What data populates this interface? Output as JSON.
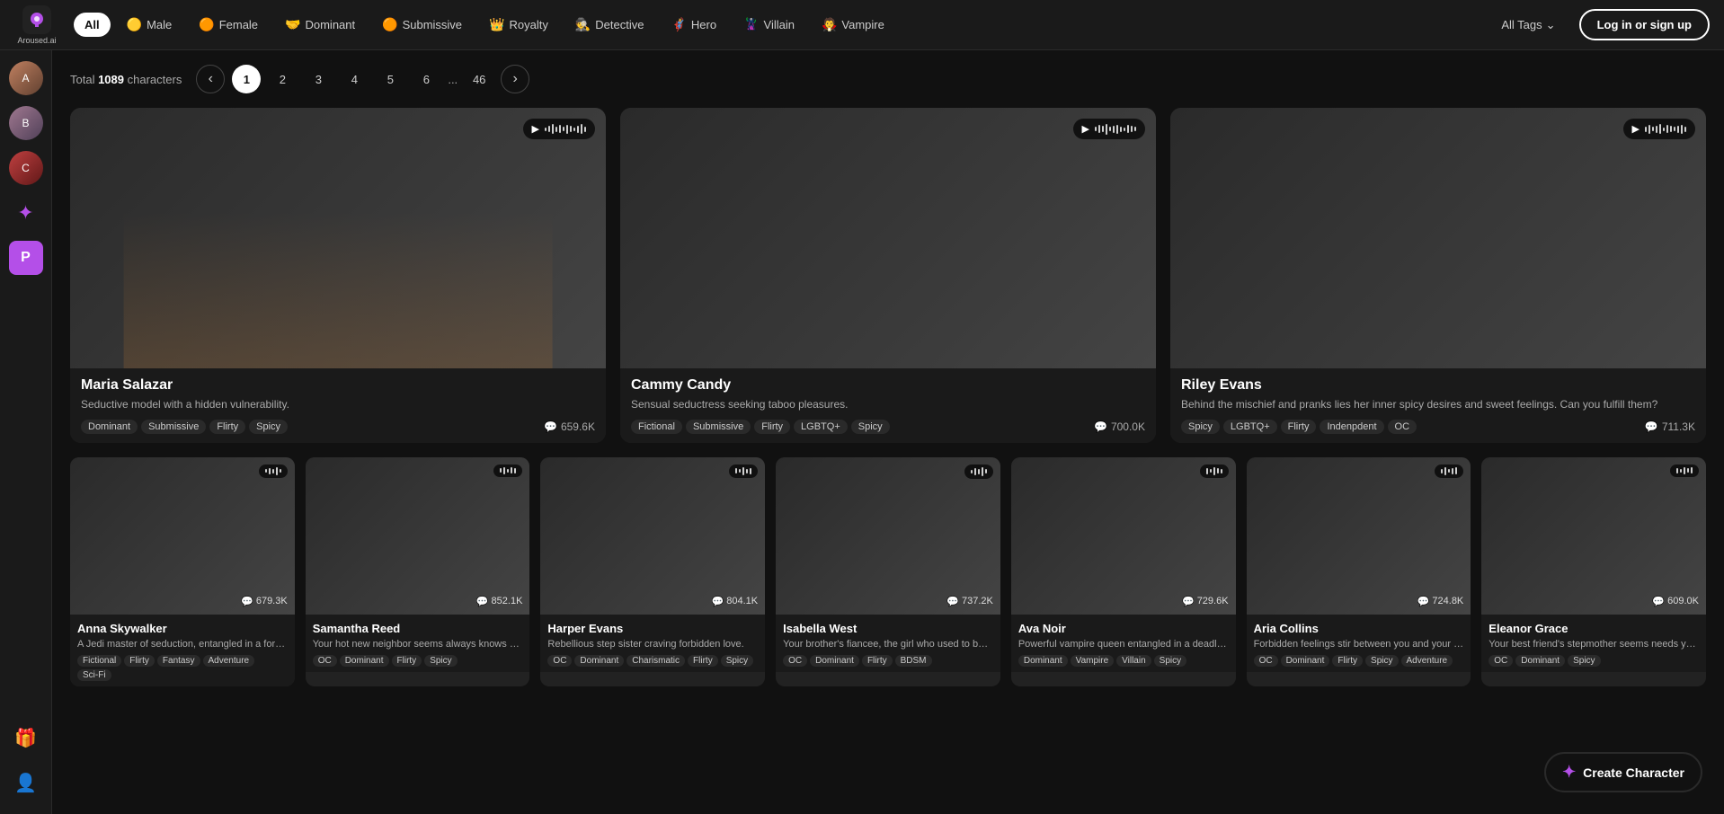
{
  "logo": {
    "icon": "A",
    "text": "Aroused.ai"
  },
  "nav": {
    "tags": [
      {
        "id": "all",
        "label": "All",
        "emoji": "",
        "active": true
      },
      {
        "id": "male",
        "label": "Male",
        "emoji": "🟡"
      },
      {
        "id": "female",
        "label": "Female",
        "emoji": "🟠"
      },
      {
        "id": "dominant",
        "label": "Dominant",
        "emoji": "🤝"
      },
      {
        "id": "submissive",
        "label": "Submissive",
        "emoji": "🟠"
      },
      {
        "id": "royalty",
        "label": "Royalty",
        "emoji": "👑"
      },
      {
        "id": "detective",
        "label": "Detective",
        "emoji": "🕵️"
      },
      {
        "id": "hero",
        "label": "Hero",
        "emoji": "🦸"
      },
      {
        "id": "villain",
        "label": "Villain",
        "emoji": "🦹"
      },
      {
        "id": "vampire",
        "label": "Vampire",
        "emoji": "🧛"
      }
    ],
    "all_tags": "All Tags",
    "login": "Log in or sign up"
  },
  "pagination": {
    "total_label": "Total",
    "total": "1089",
    "unit": "characters",
    "pages": [
      "1",
      "2",
      "3",
      "4",
      "5",
      "6",
      "...",
      "46"
    ],
    "active_page": "1"
  },
  "featured_cards": [
    {
      "id": "maria-salazar",
      "name": "Maria Salazar",
      "desc": "Seductive model with a hidden vulnerability.",
      "tags": [
        "Dominant",
        "Submissive",
        "Flirty",
        "Spicy"
      ],
      "stat": "659.6K",
      "gradient": "fc1"
    },
    {
      "id": "cammy-candy",
      "name": "Cammy Candy",
      "desc": "Sensual seductress seeking taboo pleasures.",
      "tags": [
        "Fictional",
        "Submissive",
        "Flirty",
        "LGBTQ+",
        "Spicy"
      ],
      "stat": "700.0K",
      "gradient": "fc2"
    },
    {
      "id": "riley-evans",
      "name": "Riley Evans",
      "desc": "Behind the mischief and pranks lies her inner spicy desires and sweet feelings. Can you fulfill them?",
      "tags": [
        "Spicy",
        "LGBTQ+",
        "Flirty",
        "Indenpdent",
        "OC"
      ],
      "stat": "711.3K",
      "gradient": "fc3"
    }
  ],
  "small_cards": [
    {
      "id": "anna-skywalker",
      "name": "Anna Skywalker",
      "desc": "A Jedi master of seduction, entangled in a forbidden crush.",
      "tags": [
        "Fictional",
        "Flirty",
        "Fantasy",
        "Adventure",
        "Sci-Fi"
      ],
      "stat": "679.3K",
      "gradient": "sc1"
    },
    {
      "id": "samantha-reed",
      "name": "Samantha Reed",
      "desc": "Your hot new neighbor seems always knows her charm to you.",
      "tags": [
        "OC",
        "Dominant",
        "Flirty",
        "Spicy"
      ],
      "stat": "852.1K",
      "gradient": "sc2"
    },
    {
      "id": "harper-evans",
      "name": "Harper Evans",
      "desc": "Rebellious step sister craving forbidden love.",
      "tags": [
        "OC",
        "Dominant",
        "Charismatic",
        "Flirty",
        "Spicy"
      ],
      "stat": "804.1K",
      "gradient": "sc3"
    },
    {
      "id": "isabella-west",
      "name": "Isabella West",
      "desc": "Your brother's fiancee, the girl who used to be your true love.",
      "tags": [
        "OC",
        "Dominant",
        "Flirty",
        "BDSM"
      ],
      "stat": "737.2K",
      "gradient": "sc4"
    },
    {
      "id": "ava-noir",
      "name": "Ava Noir",
      "desc": "Powerful vampire queen entangled in a deadly dance.",
      "tags": [
        "Dominant",
        "Vampire",
        "Villain",
        "Spicy"
      ],
      "stat": "729.6K",
      "gradient": "sc5"
    },
    {
      "id": "aria-collins",
      "name": "Aria Collins",
      "desc": "Forbidden feelings stir between you and your sister's bestie.",
      "tags": [
        "OC",
        "Dominant",
        "Flirty",
        "Spicy",
        "Adventure"
      ],
      "stat": "724.8K",
      "gradient": "sc6"
    },
    {
      "id": "eleanor-grace",
      "name": "Eleanor Grace",
      "desc": "Your best friend's stepmother seems needs yo...",
      "tags": [
        "OC",
        "Dominant",
        "Spicy"
      ],
      "stat": "609.0K",
      "gradient": "sc7"
    }
  ],
  "sidebar": {
    "avatars": [
      "A1",
      "A2",
      "A3"
    ],
    "sparkle_label": "✦",
    "p_label": "P"
  },
  "create_char": {
    "label": "Create Character",
    "sparkle": "✦"
  },
  "icons": {
    "play": "▶",
    "chat": "💬",
    "chevron_right": "›",
    "chevron_left": "‹",
    "chevron_down": "⌄",
    "gift": "🎁",
    "user": "👤"
  },
  "waveform_heights": [
    4,
    7,
    10,
    6,
    12,
    8,
    5,
    9,
    11,
    7,
    4,
    8,
    6,
    10,
    5,
    7,
    9,
    4,
    8,
    6
  ]
}
